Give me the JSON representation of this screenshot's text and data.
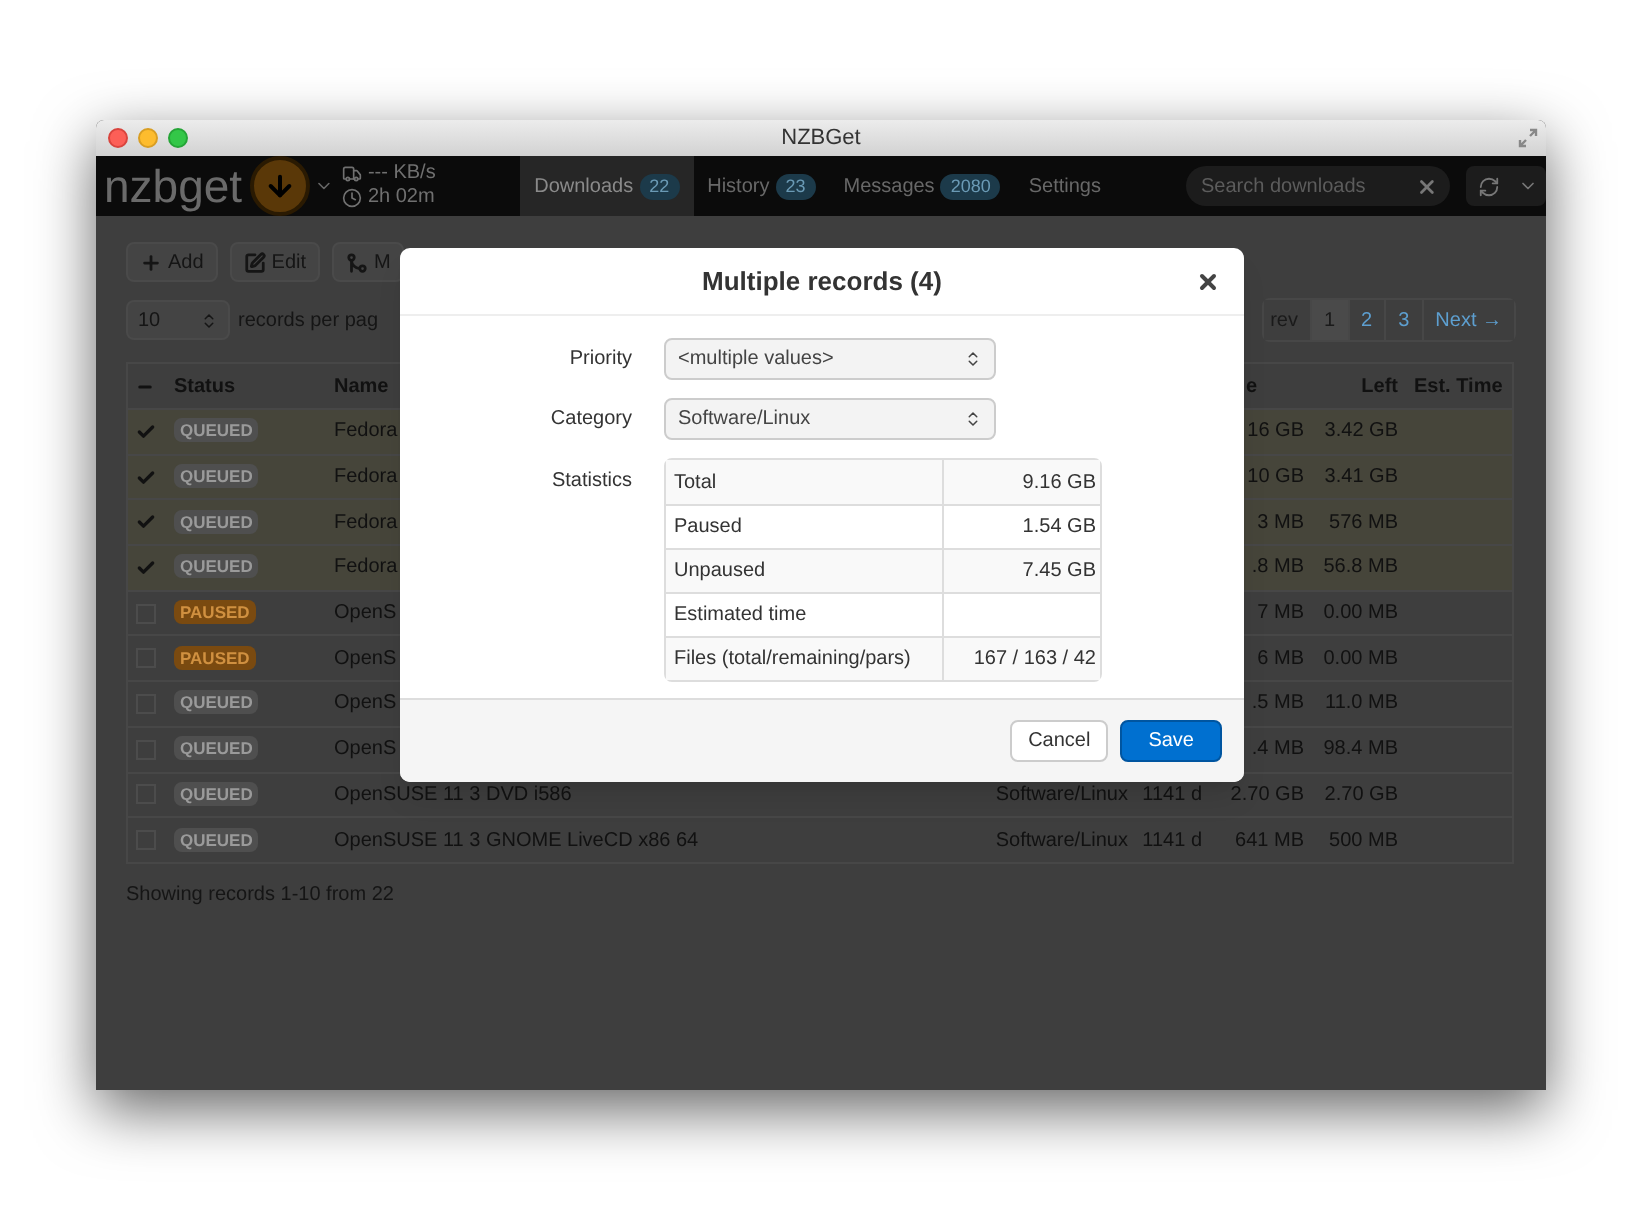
{
  "window": {
    "title": "NZBGet"
  },
  "navbar": {
    "logo": "nzbget",
    "speed": "--- KB/s",
    "time_left": "2h 02m",
    "tabs": [
      {
        "label": "Downloads",
        "count": "22",
        "selected": true
      },
      {
        "label": "History",
        "count": "23",
        "selected": false
      },
      {
        "label": "Messages",
        "count": "2080",
        "selected": false
      },
      {
        "label": "Settings",
        "selected": false
      }
    ],
    "search": {
      "placeholder": "Search downloads"
    }
  },
  "toolbar": {
    "buttons": [
      {
        "label": "Add",
        "kind": "add"
      },
      {
        "label": "Edit",
        "kind": "edit"
      },
      {
        "label": "M",
        "kind": "merge"
      }
    ]
  },
  "pager": {
    "page_size": "10",
    "page_size_label": "records per pag",
    "pages": [
      {
        "label": "rev",
        "disabled": true,
        "selected": false
      },
      {
        "label": "1",
        "disabled": false,
        "selected": true
      },
      {
        "label": "2",
        "disabled": false,
        "selected": false
      },
      {
        "label": "3",
        "disabled": false,
        "selected": false
      },
      {
        "label": "Next →",
        "disabled": false,
        "selected": false
      }
    ]
  },
  "table": {
    "columns": {
      "status": "Status",
      "name": "Name",
      "size": "e",
      "left": "Left",
      "est": "Est. Time"
    },
    "rows": [
      {
        "selected": true,
        "status": "QUEUED",
        "kind": "queued",
        "name": "Fedora",
        "size": "16 GB",
        "left": "3.42 GB"
      },
      {
        "selected": true,
        "status": "QUEUED",
        "kind": "queued",
        "name": "Fedora",
        "size": "10 GB",
        "left": "3.41 GB"
      },
      {
        "selected": true,
        "status": "QUEUED",
        "kind": "queued",
        "name": "Fedora",
        "size": "3 MB",
        "left": "576 MB"
      },
      {
        "selected": true,
        "status": "QUEUED",
        "kind": "queued",
        "name": "Fedora",
        "size": ".8 MB",
        "left": "56.8 MB"
      },
      {
        "selected": false,
        "status": "PAUSED",
        "kind": "paused",
        "name": "OpenS",
        "size": "7 MB",
        "left": "0.00 MB"
      },
      {
        "selected": false,
        "status": "PAUSED",
        "kind": "paused",
        "name": "OpenS",
        "size": "6 MB",
        "left": "0.00 MB"
      },
      {
        "selected": false,
        "status": "QUEUED",
        "kind": "queued",
        "name": "OpenS",
        "size": ".5 MB",
        "left": "11.0 MB"
      },
      {
        "selected": false,
        "status": "QUEUED",
        "kind": "queued",
        "name": "OpenS",
        "size": ".4 MB",
        "left": "98.4 MB"
      },
      {
        "selected": false,
        "status": "QUEUED",
        "kind": "queued",
        "name": "OpenSUSE 11 3 DVD i586",
        "category": "Software/Linux",
        "age": "1141 d",
        "size": "2.70 GB",
        "left": "2.70 GB"
      },
      {
        "selected": false,
        "status": "QUEUED",
        "kind": "queued",
        "name": "OpenSUSE 11 3 GNOME LiveCD x86 64",
        "category": "Software/Linux",
        "age": "1141 d",
        "size": "641 MB",
        "left": "500 MB"
      }
    ]
  },
  "footer": "Showing records 1-10 from 22",
  "dialog": {
    "title": "Multiple records (4)",
    "fields": [
      {
        "label": "Priority",
        "value": "<multiple values>"
      },
      {
        "label": "Category",
        "value": "Software/Linux"
      }
    ],
    "statistics_label": "Statistics",
    "statistics": [
      {
        "name": "Total",
        "value": "9.16 GB"
      },
      {
        "name": "Paused",
        "value": "1.54 GB"
      },
      {
        "name": "Unpaused",
        "value": "7.45 GB"
      },
      {
        "name": "Estimated time"
      },
      {
        "name": "Files (total/remaining/pars)",
        "value": "167 / 163 / 42"
      }
    ],
    "buttons": [
      {
        "label": "Cancel",
        "kind": "default"
      },
      {
        "label": "Save",
        "kind": "primary"
      }
    ]
  }
}
